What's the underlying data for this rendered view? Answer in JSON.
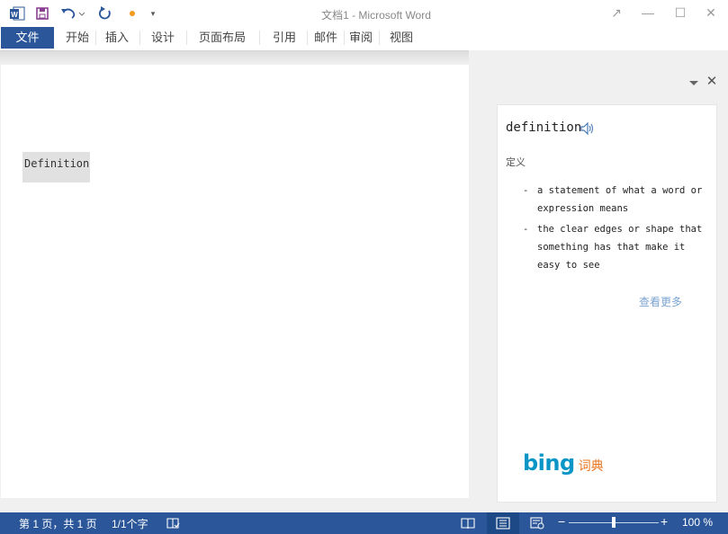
{
  "window": {
    "title": "文档1 - Microsoft Word",
    "controls": {
      "restore": "↗",
      "minimize": "—",
      "maximize": "☐",
      "close": "✕"
    }
  },
  "quick_access": {
    "icons": [
      "word-app-icon",
      "save-icon",
      "undo-icon",
      "redo-icon",
      "touch-mode-icon",
      "customize-qat-icon"
    ],
    "customize_glyph": "▾"
  },
  "ribbon": {
    "file_tab": "文件",
    "tabs": [
      "开始",
      "插入",
      "设计",
      "页面布局",
      "引用",
      "邮件",
      "审阅",
      "视图"
    ]
  },
  "document": {
    "selected_text": "Definition"
  },
  "task_pane": {
    "close_glyph": "✕",
    "word": "definition",
    "part_of_speech": "定义",
    "definitions": [
      {
        "dash": "-",
        "text": "a statement of what a word or expression means"
      },
      {
        "dash": "-",
        "text": "the clear edges or shape that something has that make it easy to see"
      }
    ],
    "see_more": "查看更多",
    "brand": {
      "logo_text": "bing",
      "product": "词典",
      "logo_color": "#0996c7",
      "product_color": "#e8741e"
    }
  },
  "status_bar": {
    "page_info": "第 1 页，共 1 页",
    "word_count": "1/1个字",
    "zoom": "100 %",
    "zoom_minus": "−",
    "zoom_plus": "+",
    "zoom_level": 0.5,
    "accent": "#2b579a"
  }
}
